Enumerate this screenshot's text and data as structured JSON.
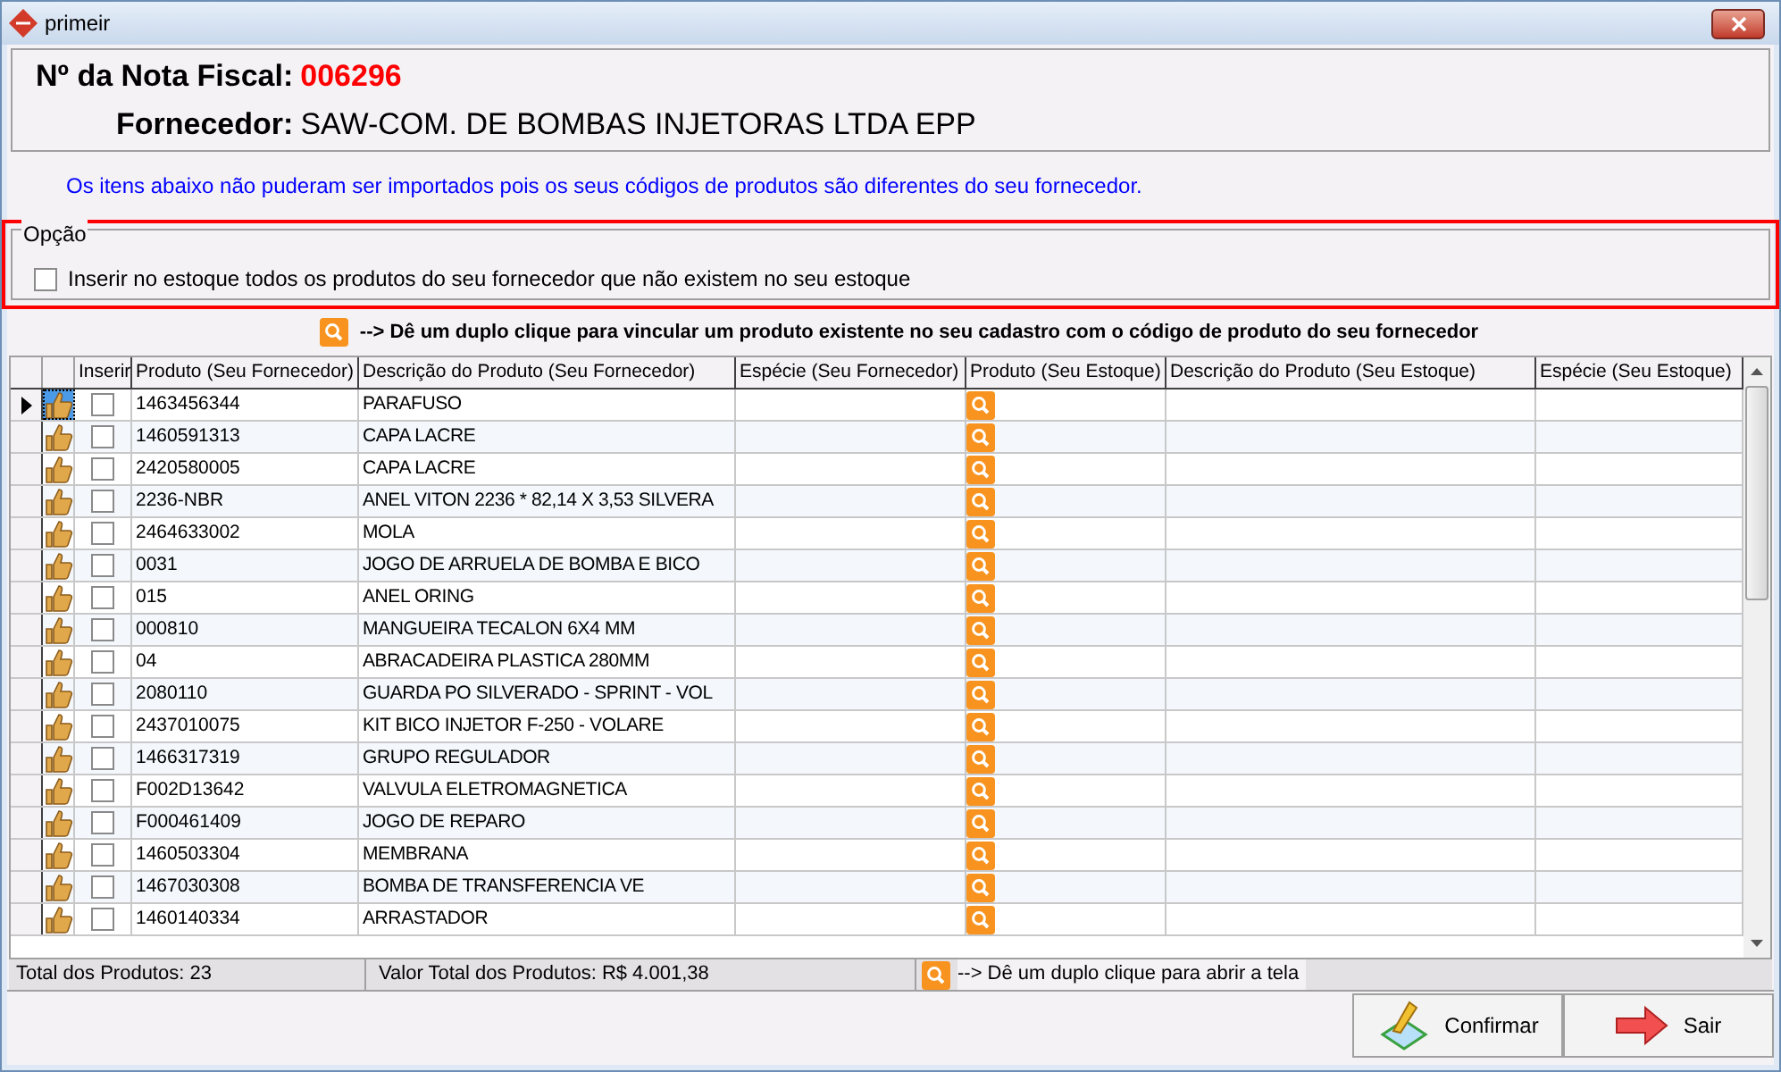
{
  "window": {
    "title": "primeir"
  },
  "header": {
    "invoice_label": "Nº da Nota Fiscal:",
    "invoice_number": "006296",
    "supplier_label": "Fornecedor:",
    "supplier": "SAW-COM. DE BOMBAS INJETORAS LTDA EPP"
  },
  "notice": "Os itens abaixo não puderam ser importados pois os seus códigos de produtos são diferentes do seu fornecedor.",
  "option_group": {
    "title": "Opção",
    "checkbox": {
      "label": "Inserir no estoque todos os produtos do seu fornecedor que não existem no seu estoque",
      "checked": false
    }
  },
  "hint": "--> Dê um duplo clique para vincular um produto existente no seu cadastro com o código de produto do seu fornecedor",
  "table": {
    "columns": [
      "Inserir",
      "Produto (Seu Fornecedor)",
      "Descrição do Produto (Seu Fornecedor)",
      "Espécie (Seu Fornecedor)",
      "Produto (Seu Estoque)",
      "Descrição do Produto (Seu Estoque)",
      "Espécie (Seu Estoque)"
    ],
    "rows": [
      {
        "selected": true,
        "inserir": false,
        "code": "1463456344",
        "description": "PARAFUSO"
      },
      {
        "selected": false,
        "inserir": false,
        "code": "1460591313",
        "description": "CAPA LACRE"
      },
      {
        "selected": false,
        "inserir": false,
        "code": "2420580005",
        "description": "CAPA LACRE"
      },
      {
        "selected": false,
        "inserir": false,
        "code": "2236-NBR",
        "description": "ANEL VITON 2236 * 82,14 X 3,53 SILVERA"
      },
      {
        "selected": false,
        "inserir": false,
        "code": "2464633002",
        "description": "MOLA"
      },
      {
        "selected": false,
        "inserir": false,
        "code": "0031",
        "description": "JOGO DE ARRUELA DE BOMBA E BICO"
      },
      {
        "selected": false,
        "inserir": false,
        "code": "015",
        "description": "ANEL ORING"
      },
      {
        "selected": false,
        "inserir": false,
        "code": "000810",
        "description": "MANGUEIRA TECALON 6X4 MM"
      },
      {
        "selected": false,
        "inserir": false,
        "code": "04",
        "description": "ABRACADEIRA PLASTICA 280MM"
      },
      {
        "selected": false,
        "inserir": false,
        "code": "2080110",
        "description": "GUARDA PO SILVERADO - SPRINT - VOL"
      },
      {
        "selected": false,
        "inserir": false,
        "code": "2437010075",
        "description": "KIT BICO INJETOR F-250 - VOLARE"
      },
      {
        "selected": false,
        "inserir": false,
        "code": "1466317319",
        "description": "GRUPO REGULADOR"
      },
      {
        "selected": false,
        "inserir": false,
        "code": "F002D13642",
        "description": "VALVULA ELETROMAGNETICA"
      },
      {
        "selected": false,
        "inserir": false,
        "code": "F000461409",
        "description": "JOGO DE REPARO"
      },
      {
        "selected": false,
        "inserir": false,
        "code": "1460503304",
        "description": "MEMBRANA"
      },
      {
        "selected": false,
        "inserir": false,
        "code": "1467030308",
        "description": "BOMBA DE TRANSFERENCIA VE"
      },
      {
        "selected": false,
        "inserir": false,
        "code": "1460140334",
        "description": "ARRASTADOR"
      }
    ]
  },
  "status_bar": {
    "total_products": "Total dos Produtos: 23",
    "total_value": "Valor Total dos Produtos: R$ 4.001,38",
    "hint": "--> Dê um duplo clique para abrir a tela"
  },
  "buttons": [
    {
      "kind": "confirm",
      "label": "Confirmar"
    },
    {
      "kind": "exit",
      "label": "Sair"
    }
  ]
}
